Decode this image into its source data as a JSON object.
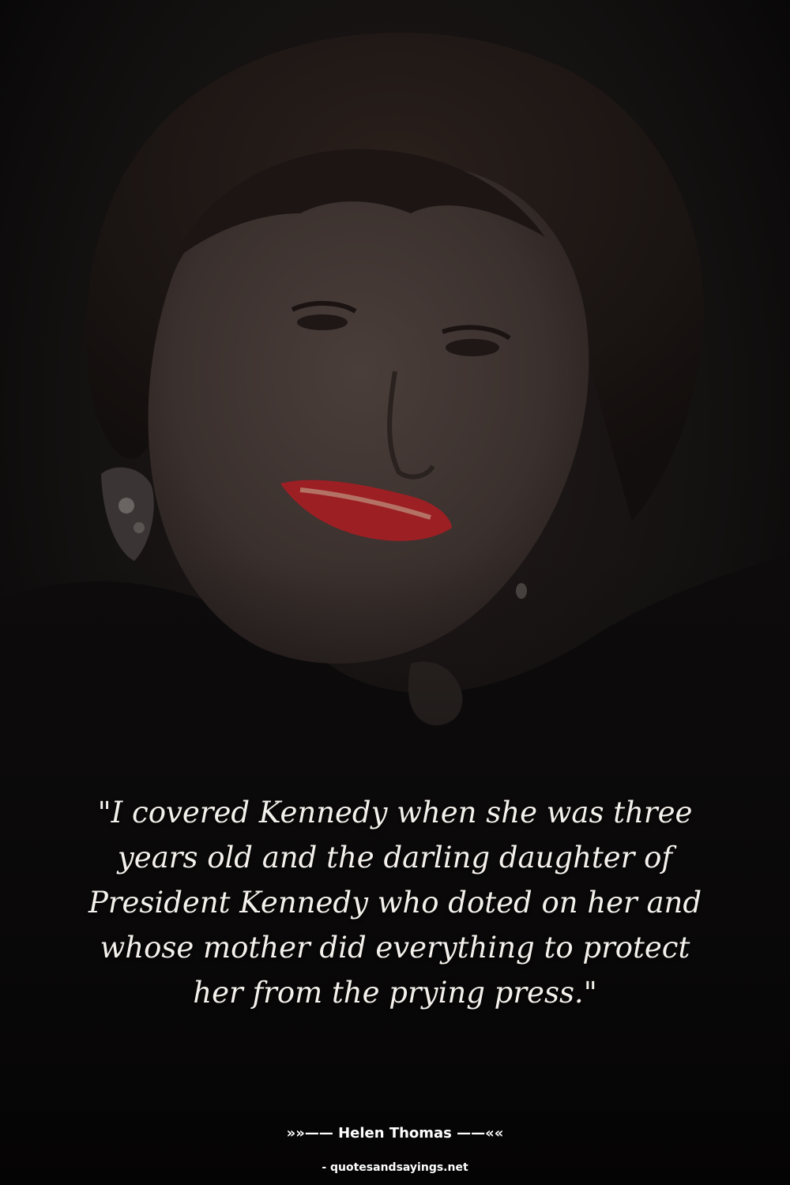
{
  "quote": {
    "text": "\"I covered Kennedy when she was three years old and the darling daughter of President Kennedy who doted on her and whose mother did everything to protect her from the prying press.\""
  },
  "attribution": {
    "text": "»»—— Helen Thomas ——««"
  },
  "source": {
    "text": "- quotesandsayings.net"
  },
  "colors": {
    "background": "#0a0909",
    "text": "#f4f1ec",
    "lipstick": "#9c1f24"
  },
  "photo": {
    "subject": "portrait-of-woman-smiling"
  }
}
